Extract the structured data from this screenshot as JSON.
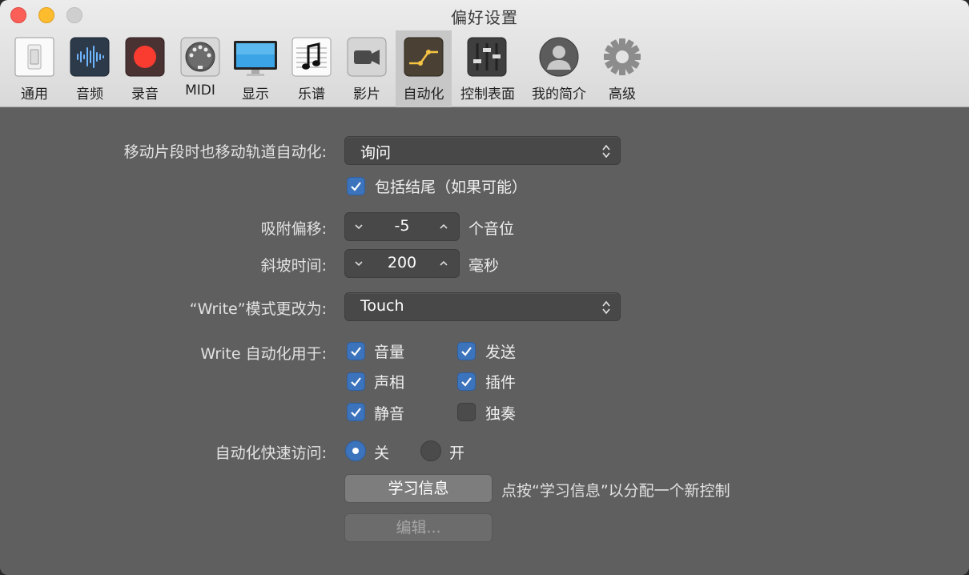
{
  "window": {
    "title": "偏好设置"
  },
  "toolbar": [
    {
      "label": "通用"
    },
    {
      "label": "音频"
    },
    {
      "label": "录音"
    },
    {
      "label": "MIDI"
    },
    {
      "label": "显示"
    },
    {
      "label": "乐谱"
    },
    {
      "label": "影片"
    },
    {
      "label": "自动化",
      "selected": true
    },
    {
      "label": "控制表面"
    },
    {
      "label": "我的简介"
    },
    {
      "label": "高级"
    }
  ],
  "automation": {
    "move_label": "移动片段时也移动轨道自动化:",
    "move_value": "询问",
    "include_tail": {
      "label": "包括结尾（如果可能）",
      "checked": true
    },
    "snap_offset": {
      "label": "吸附偏移:",
      "value": "-5",
      "unit": "个音位"
    },
    "ramp_time": {
      "label": "斜坡时间:",
      "value": "200",
      "unit": "毫秒"
    },
    "write_change_label": "“Write”模式更改为:",
    "write_change_value": "Touch",
    "write_for_label": "Write 自动化用于:",
    "write_for": [
      {
        "label": "音量",
        "checked": true
      },
      {
        "label": "发送",
        "checked": true
      },
      {
        "label": "声相",
        "checked": true
      },
      {
        "label": "插件",
        "checked": true
      },
      {
        "label": "静音",
        "checked": true
      },
      {
        "label": "独奏",
        "checked": false
      }
    ],
    "quick_access_label": "自动化快速访问:",
    "quick_access": {
      "off_label": "关",
      "on_label": "开",
      "selected": "关"
    },
    "learn_button": "学习信息",
    "learn_hint": "点按“学习信息”以分配一个新控制",
    "edit_button": "编辑..."
  },
  "colors": {
    "accent": "#3c73bd",
    "background": "#5f5f5f",
    "toolbar_bg": "#e3e3e3"
  }
}
